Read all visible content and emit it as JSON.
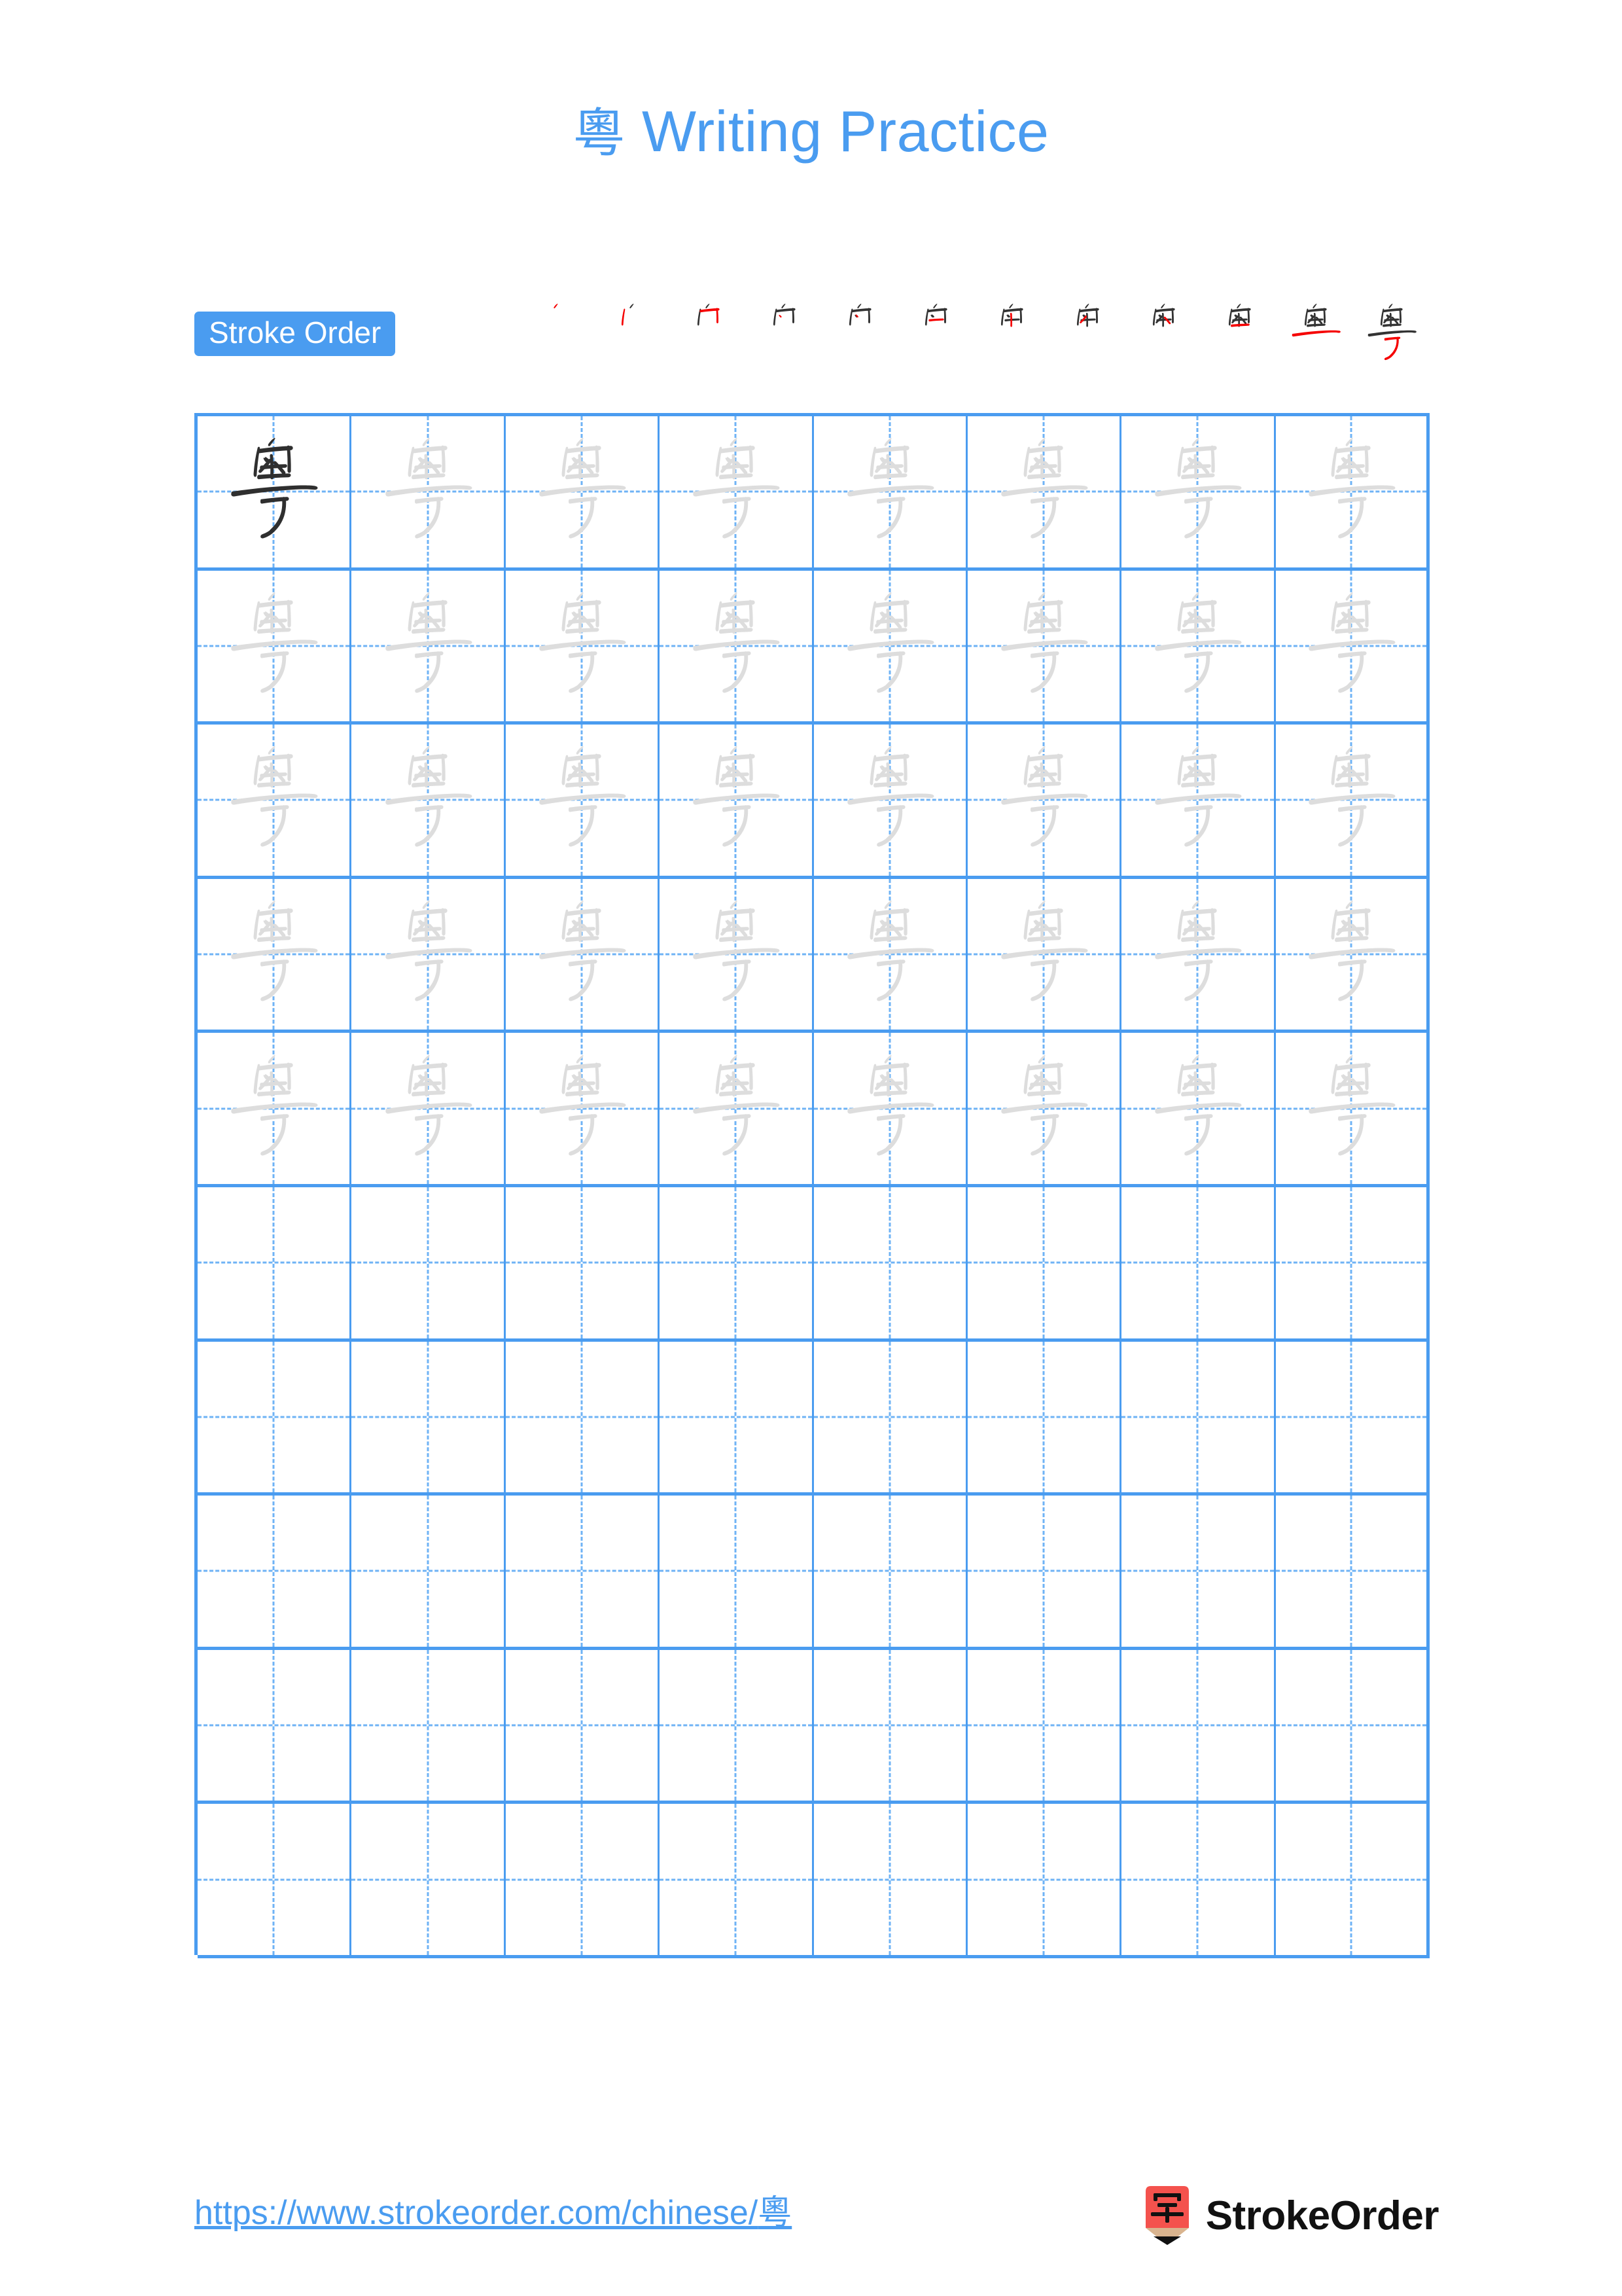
{
  "page": {
    "character": "粵",
    "title_suffix": " Writing Practice",
    "background_color": "#ffffff",
    "accent_color": "#4a9cf0",
    "stroke_highlight_color": "#f50000",
    "stroke_ink_color": "#333333",
    "trace_color": "#dddddd"
  },
  "stroke_order": {
    "badge_label": "Stroke Order",
    "total_strokes": 12,
    "steps": [
      1,
      2,
      3,
      4,
      5,
      6,
      7,
      8,
      9,
      10,
      11,
      12
    ]
  },
  "grid": {
    "columns": 8,
    "rows": 10,
    "filled_rows": 5,
    "empty_rows": 5,
    "first_cell_style": "solid-dark",
    "traced_cell_style": "light-gray-outline"
  },
  "footer": {
    "url_text": "https://www.strokeorder.com/chinese/",
    "url_character": "粵",
    "brand_name": "StrokeOrder",
    "brand_logo_character": "字",
    "brand_logo_color": "#f4524d"
  }
}
